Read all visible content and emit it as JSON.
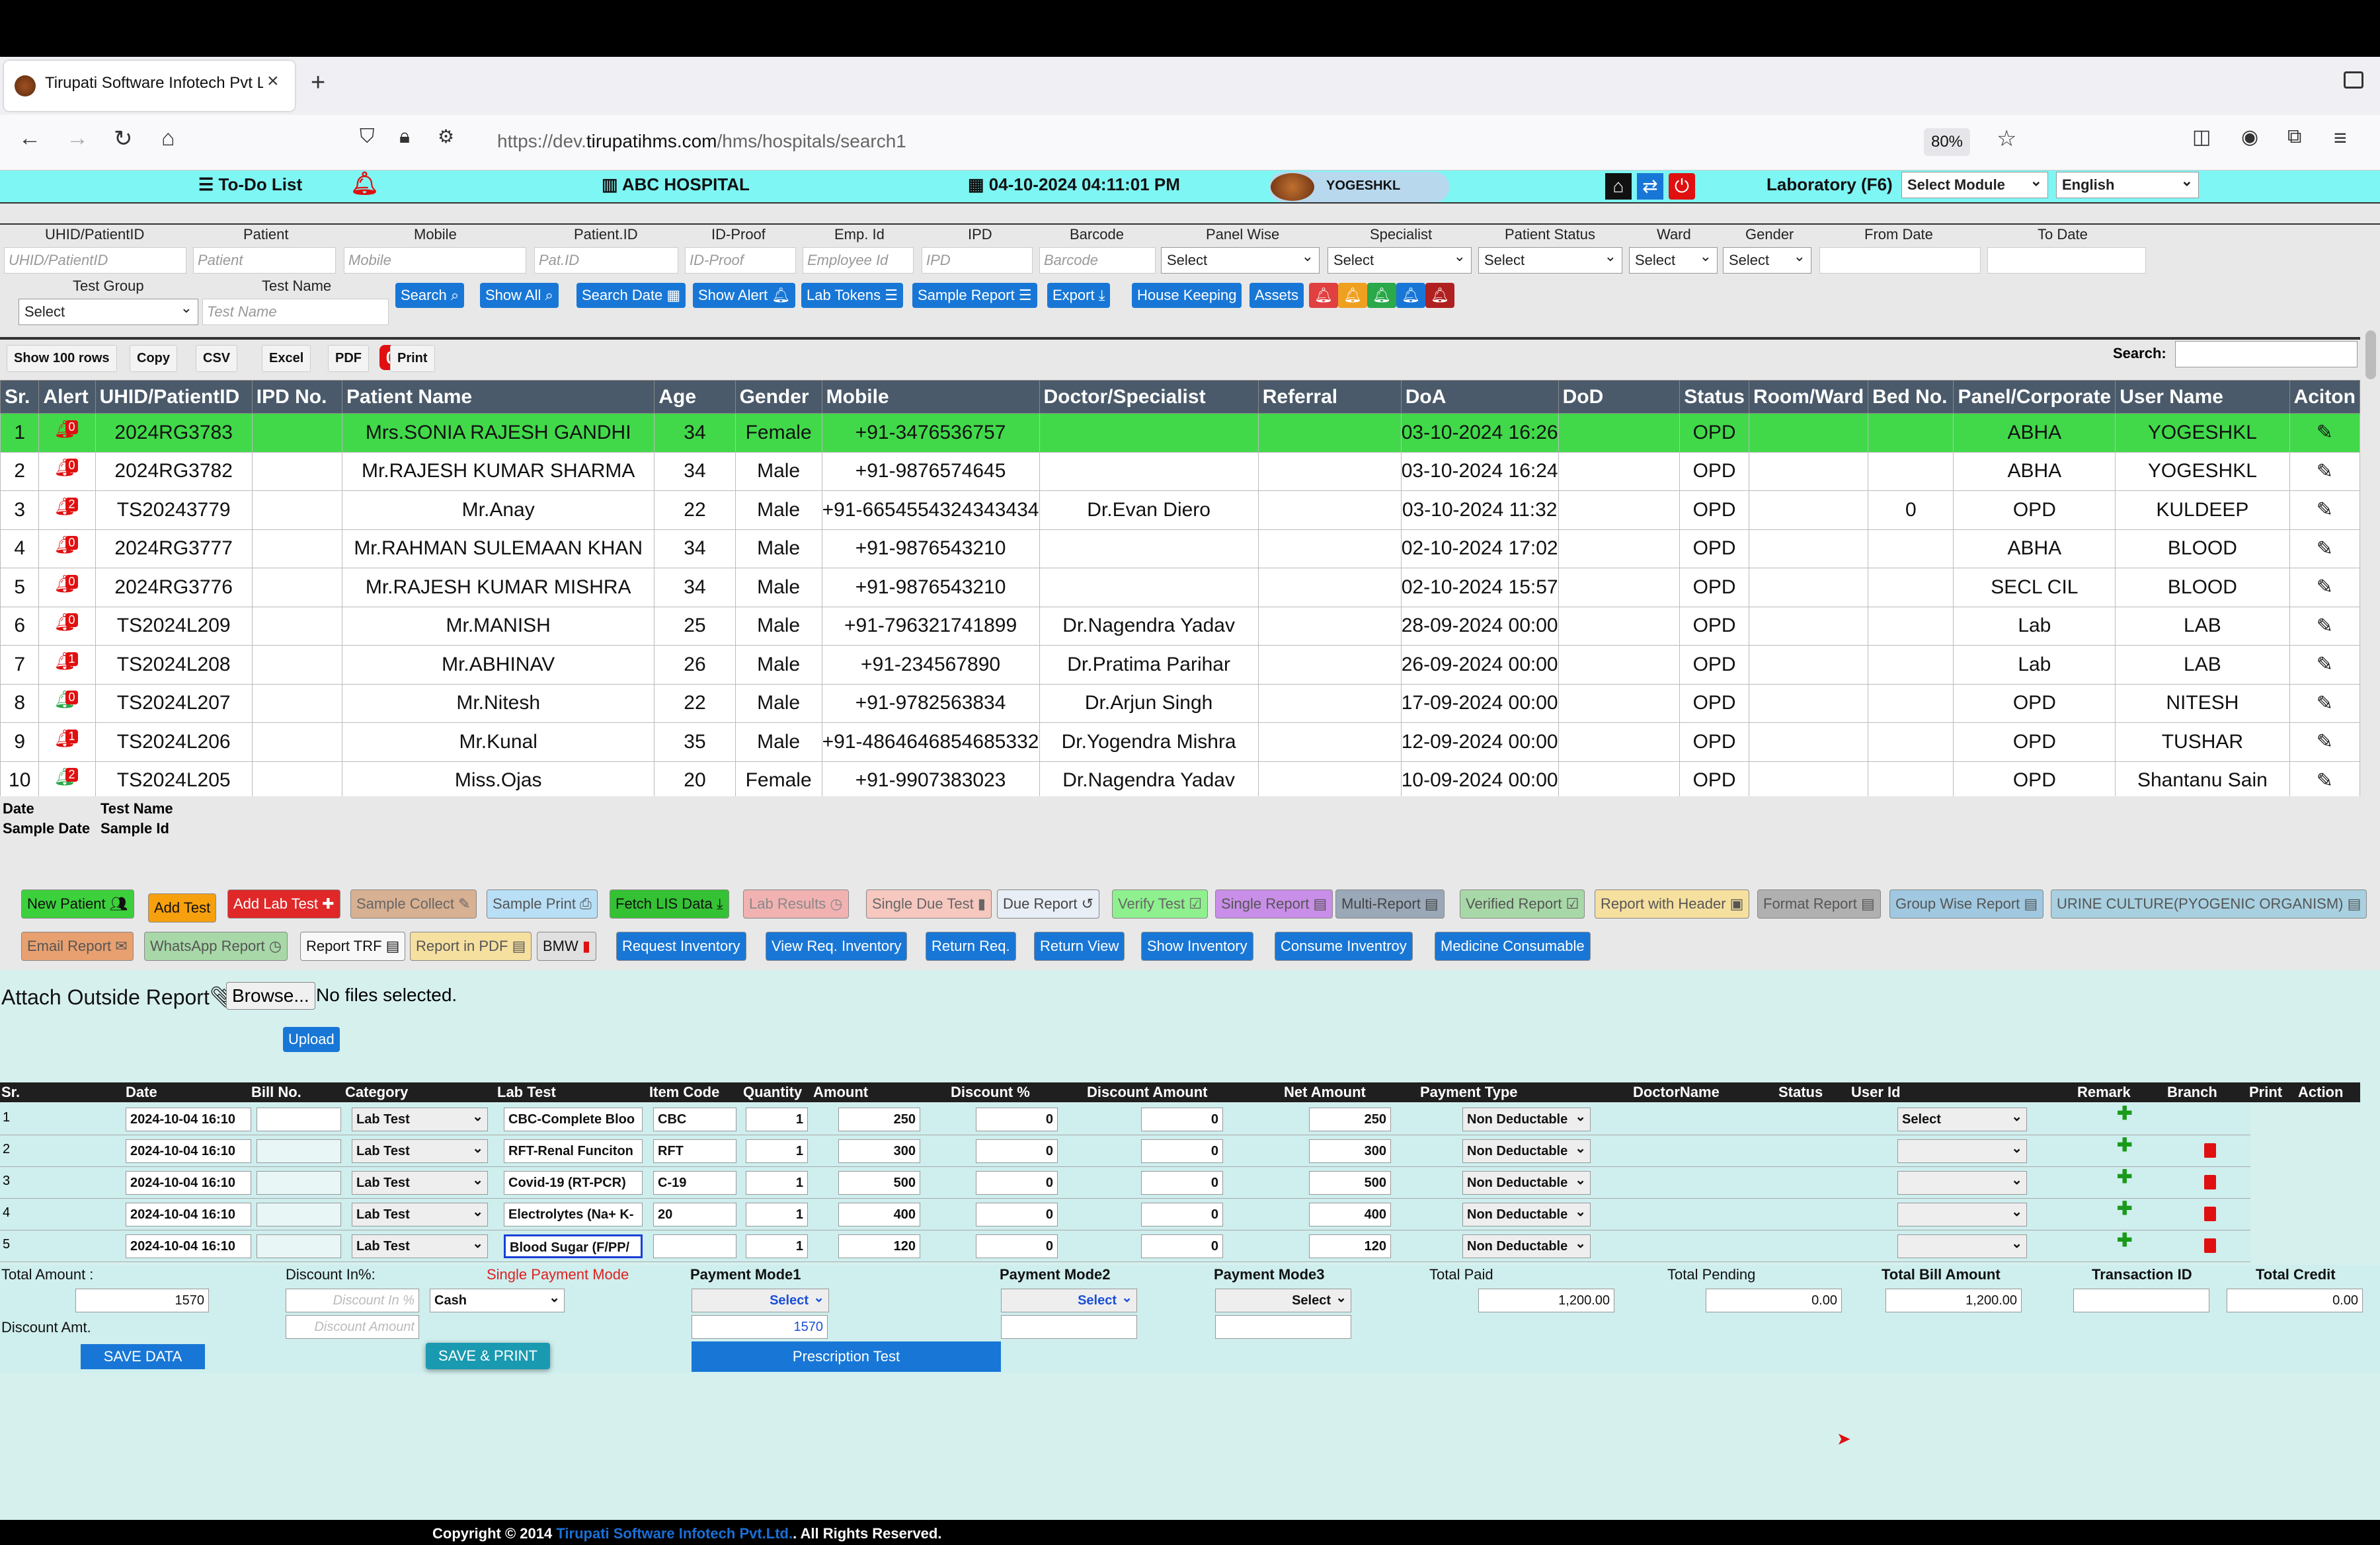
{
  "browser": {
    "tab_title": "Tirupati Software Infotech Pvt Lt",
    "url_prefix": "https://dev.",
    "url_host": "tirupatihms.com",
    "url_path": "/hms/hospitals/search1",
    "zoom": "80%"
  },
  "topbar": {
    "todo": "To-Do List",
    "alert_count": "0",
    "hospital": "ABC HOSPITAL",
    "datetime": "04-10-2024 04:11:01 PM",
    "user": "YOGESHKL",
    "module": "Laboratory (F6)",
    "select_module": "Select Module",
    "language": "English"
  },
  "filters": {
    "labels": [
      "UHID/PatientID",
      "Patient",
      "Mobile",
      "Patient.ID",
      "ID-Proof",
      "Emp. Id",
      "IPD",
      "Barcode",
      "Panel Wise",
      "Specialist",
      "Patient Status",
      "Ward",
      "Gender",
      "From Date",
      "To Date"
    ],
    "placeholders": [
      "UHID/PatientID",
      "Patient",
      "Mobile",
      "Pat.ID",
      "ID-Proof",
      "Employee Id",
      "IPD",
      "Barcode"
    ],
    "select": "Select",
    "test_group": "Test Group",
    "test_name": "Test Name",
    "test_name_ph": "Test Name"
  },
  "actions": [
    "Search",
    "Show All",
    "Search Date",
    "Show Alert",
    "Lab Tokens",
    "Sample Report",
    "Export",
    "House Keeping",
    "Assets"
  ],
  "export_buttons": [
    "Show 100 rows",
    "Copy",
    "CSV",
    "Excel",
    "PDF",
    "Print"
  ],
  "search_label": "Search:",
  "table": {
    "headers": [
      "Sr.",
      "Alert",
      "UHID/PatientID",
      "IPD No.",
      "Patient Name",
      "Age",
      "Gender",
      "Mobile",
      "Doctor/Specialist",
      "Referral",
      "DoA",
      "DoD",
      "Status",
      "Room/Ward",
      "Bed No.",
      "Panel/Corporate",
      "User Name",
      "Aciton"
    ],
    "rows": [
      [
        "1",
        "0",
        "2024RG3783",
        "",
        "Mrs.SONIA RAJESH GANDHI",
        "34",
        "Female",
        "+91-3476536757",
        "",
        "",
        "03-10-2024 16:26",
        "",
        "OPD",
        "",
        "",
        "ABHA",
        "YOGESHKL"
      ],
      [
        "2",
        "0",
        "2024RG3782",
        "",
        "Mr.RAJESH KUMAR SHARMA",
        "34",
        "Male",
        "+91-9876574645",
        "",
        "",
        "03-10-2024 16:24",
        "",
        "OPD",
        "",
        "",
        "ABHA",
        "YOGESHKL"
      ],
      [
        "3",
        "2",
        "TS20243779",
        "",
        "Mr.Anay",
        "22",
        "Male",
        "+91-6654554324343434",
        "Dr.Evan Diero",
        "",
        "03-10-2024 11:32",
        "",
        "OPD",
        "",
        "0",
        "OPD",
        "KULDEEP"
      ],
      [
        "4",
        "0",
        "2024RG3777",
        "",
        "Mr.RAHMAN SULEMAAN KHAN",
        "34",
        "Male",
        "+91-9876543210",
        "",
        "",
        "02-10-2024 17:02",
        "",
        "OPD",
        "",
        "",
        "ABHA",
        "BLOOD"
      ],
      [
        "5",
        "0",
        "2024RG3776",
        "",
        "Mr.RAJESH KUMAR MISHRA",
        "34",
        "Male",
        "+91-9876543210",
        "",
        "",
        "02-10-2024 15:57",
        "",
        "OPD",
        "",
        "",
        "SECL CIL",
        "BLOOD"
      ],
      [
        "6",
        "0",
        "TS2024L209",
        "",
        "Mr.MANISH",
        "25",
        "Male",
        "+91-796321741899",
        "Dr.Nagendra Yadav",
        "",
        "28-09-2024 00:00",
        "",
        "OPD",
        "",
        "",
        "Lab",
        "LAB"
      ],
      [
        "7",
        "1",
        "TS2024L208",
        "",
        "Mr.ABHINAV",
        "26",
        "Male",
        "+91-234567890",
        "Dr.Pratima Parihar",
        "",
        "26-09-2024 00:00",
        "",
        "OPD",
        "",
        "",
        "Lab",
        "LAB"
      ],
      [
        "8",
        "0",
        "TS2024L207",
        "",
        "Mr.Nitesh",
        "22",
        "Male",
        "+91-9782563834",
        "Dr.Arjun Singh",
        "",
        "17-09-2024 00:00",
        "",
        "OPD",
        "",
        "",
        "OPD",
        "NITESH"
      ],
      [
        "9",
        "1",
        "TS2024L206",
        "",
        "Mr.Kunal",
        "35",
        "Male",
        "+91-4864646854685332",
        "Dr.Yogendra Mishra",
        "",
        "12-09-2024 00:00",
        "",
        "OPD",
        "",
        "",
        "OPD",
        "TUSHAR"
      ],
      [
        "10",
        "2",
        "TS2024L205",
        "",
        "Miss.Ojas",
        "20",
        "Female",
        "+91-9907383023",
        "Dr.Nagendra Yadav",
        "",
        "10-09-2024 00:00",
        "",
        "OPD",
        "",
        "",
        "OPD",
        "Shantanu Sain"
      ]
    ]
  },
  "sub_labels": [
    "Date",
    "Test Name",
    "Sample Date",
    "Sample Id"
  ],
  "module_buttons_row1": [
    "New Patient",
    "Add Test",
    "Add Lab Test",
    "Sample Collect",
    "Sample Print",
    "Fetch LIS Data",
    "Lab Results",
    "Single Due Test",
    "Due Report",
    "Verify Test",
    "Single Report",
    "Multi-Report",
    "Verified Report",
    "Report with Header",
    "Format Report",
    "Group Wise Report",
    "URINE CULTURE(PYOGENIC ORGANISM)"
  ],
  "module_buttons_row2": [
    "Email Report",
    "WhatsApp Report",
    "Report TRF",
    "Report in PDF",
    "BMW",
    "Request Inventory",
    "View Req. Inventory",
    "Return Req.",
    "Return View",
    "Show Inventory",
    "Consume Inventroy",
    "Medicine Consumable"
  ],
  "attach": {
    "label": "Attach Outside Report",
    "browse": "Browse...",
    "nofile": "No files selected.",
    "upload": "Upload"
  },
  "bill": {
    "headers": [
      "Sr.",
      "Date",
      "Bill No.",
      "Category",
      "Lab Test",
      "Item Code",
      "Quantity",
      "Amount",
      "Discount %",
      "Discount Amount",
      "Net Amount",
      "Payment Type",
      "DoctorName",
      "Status",
      "User Id",
      "Remark",
      "Branch",
      "Print",
      "Action"
    ],
    "rows": [
      [
        "1",
        "2024-10-04 16:10",
        "",
        "Lab Test",
        "CBC-Complete Bloo",
        "CBC",
        "1",
        "250",
        "0",
        "0",
        "250",
        "Non Deductable"
      ],
      [
        "2",
        "2024-10-04 16:10",
        "",
        "Lab Test",
        "RFT-Renal Funciton",
        "RFT",
        "1",
        "300",
        "0",
        "0",
        "300",
        "Non Deductable"
      ],
      [
        "3",
        "2024-10-04 16:10",
        "",
        "Lab Test",
        "Covid-19 (RT-PCR)",
        "C-19",
        "1",
        "500",
        "0",
        "0",
        "500",
        "Non Deductable"
      ],
      [
        "4",
        "2024-10-04 16:10",
        "",
        "Lab Test",
        "Electrolytes (Na+ K-",
        "20",
        "1",
        "400",
        "0",
        "0",
        "400",
        "Non Deductable"
      ],
      [
        "5",
        "2024-10-04 16:10",
        "",
        "Lab Test",
        "Blood Sugar (F/PP/",
        "",
        "1",
        "120",
        "0",
        "0",
        "120",
        "Non Deductable"
      ]
    ],
    "user_select": "Select"
  },
  "summary": {
    "total_amount_lbl": "Total Amount :",
    "total_amount": "1570",
    "discount_pct_lbl": "Discount In%:",
    "discount_pct_ph": "Discount In %",
    "single_mode_lbl": "Single Payment Mode",
    "single_mode": "Cash",
    "pm1_lbl": "Payment Mode1",
    "pm1": "Select",
    "pm1_amount": "1570",
    "pm2_lbl": "Payment Mode2",
    "pm2": "Select",
    "pm3_lbl": "Payment Mode3",
    "pm3": "Select",
    "total_paid_lbl": "Total Paid",
    "total_paid": "1,200.00",
    "total_pending_lbl": "Total Pending",
    "total_pending": "0.00",
    "total_bill_lbl": "Total Bill Amount",
    "total_bill": "1,200.00",
    "txn_lbl": "Transaction ID",
    "credit_lbl": "Total Credit",
    "credit": "0.00",
    "disc_amt_lbl": "Discount Amt.",
    "disc_amt_ph": "Discount Amount",
    "save": "SAVE DATA",
    "save_print": "SAVE & PRINT",
    "prescription": "Prescription Test"
  },
  "footer": {
    "prefix": "Copyright © 2014 ",
    "company": "Tirupati Software Infotech Pvt.Ltd.",
    "suffix": ". All Rights Reserved."
  }
}
